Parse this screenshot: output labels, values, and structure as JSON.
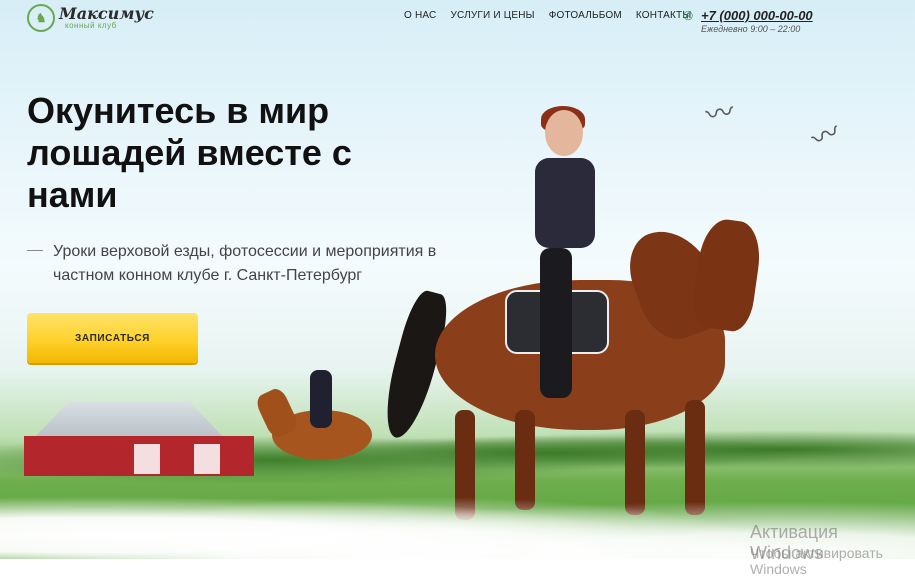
{
  "brand": {
    "logo_title": "Максимус",
    "logo_subtitle": "конный клуб"
  },
  "nav": {
    "items": [
      {
        "label": "О НАС"
      },
      {
        "label": "УСЛУГИ И ЦЕНЫ"
      },
      {
        "label": "ФОТОАЛЬБОМ"
      },
      {
        "label": "КОНТАКТЫ"
      }
    ]
  },
  "contact": {
    "phone": "+7 (000) 000-00-00",
    "hours": "Ежедневно 9:00 – 22:00"
  },
  "hero": {
    "headline": "Окунитесь в мир лошадей вместе с нами",
    "subtext": "Уроки верховой езды, фотосессии и мероприятия в частном конном клубе г. Санкт-Петербург",
    "cta_label": "ЗАПИСАТЬСЯ"
  },
  "overlay": {
    "activation_title": "Активация Windows",
    "activation_hint": "Чтобы активировать Windows"
  },
  "colors": {
    "accent": "#ffd12b",
    "brand_green": "#6aa84f"
  },
  "icons": {
    "phone": "phone-icon",
    "logo": "horse-logo-icon"
  }
}
